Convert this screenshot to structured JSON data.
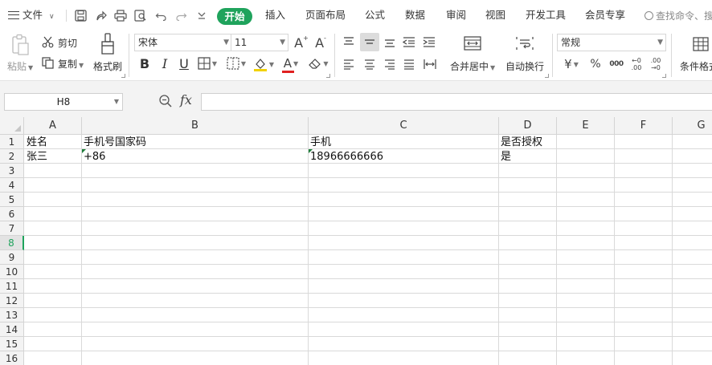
{
  "menu": {
    "file_label": "文件",
    "tabs": [
      "开始",
      "插入",
      "页面布局",
      "公式",
      "数据",
      "审阅",
      "视图",
      "开发工具",
      "会员专享"
    ],
    "search_placeholder": "查找命令、搜"
  },
  "ribbon": {
    "paste_label": "粘贴",
    "cut_label": "剪切",
    "copy_label": "复制",
    "format_painter_label": "格式刷",
    "font_name": "宋体",
    "font_size": "11",
    "number_format": "常规",
    "merge_center_label": "合并居中",
    "wrap_text_label": "自动换行",
    "conditional_format_label": "条件格式",
    "currency_symbol": "¥",
    "percent_symbol": "%",
    "thousands_symbol": "000",
    "inc_decimal_label": "←0 .00",
    "dec_decimal_label": ".00 →0"
  },
  "formula_bar": {
    "name_box": "H8",
    "fx_label": "fx",
    "formula_value": ""
  },
  "sheet": {
    "columns": [
      "A",
      "B",
      "C",
      "D",
      "E",
      "F",
      "G"
    ],
    "rows": [
      "1",
      "2",
      "3",
      "4",
      "5",
      "6",
      "7",
      "8",
      "9",
      "10",
      "11",
      "12",
      "13",
      "14",
      "15",
      "16"
    ],
    "active_row": "8",
    "cells": {
      "A1": "姓名",
      "B1": "手机号国家码",
      "C1": "手机",
      "D1": "是否授权",
      "A2": "张三",
      "B2": "+86",
      "C2": "18966666666",
      "D2": "是"
    }
  },
  "colors": {
    "accent": "#1fa35c",
    "font_color_underline": "#e02020",
    "fill_color_underline": "#f2d200"
  }
}
